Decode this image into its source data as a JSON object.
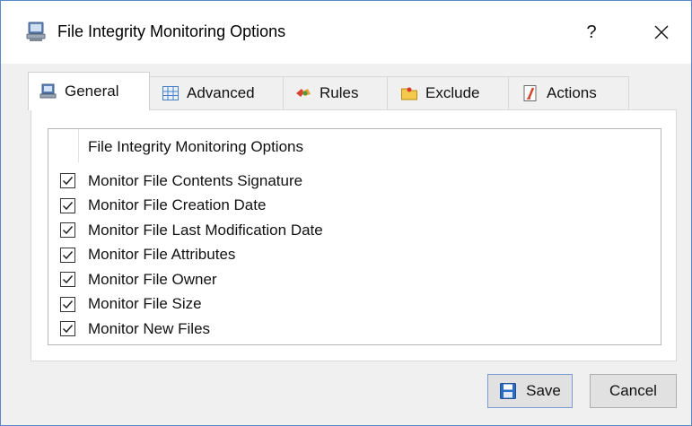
{
  "window": {
    "title": "File Integrity Monitoring Options",
    "help_glyph": "?",
    "close_glyph": "×"
  },
  "tabs": [
    {
      "label": "General",
      "icon": "computer-icon",
      "active": true
    },
    {
      "label": "Advanced",
      "icon": "grid-icon",
      "active": false
    },
    {
      "label": "Rules",
      "icon": "rules-icon",
      "active": false
    },
    {
      "label": "Exclude",
      "icon": "folder-icon",
      "active": false
    },
    {
      "label": "Actions",
      "icon": "actions-icon",
      "active": false
    }
  ],
  "list": {
    "header": "File Integrity Monitoring Options",
    "items": [
      {
        "label": "Monitor File Contents Signature",
        "checked": true
      },
      {
        "label": "Monitor File Creation Date",
        "checked": true
      },
      {
        "label": "Monitor File Last Modification Date",
        "checked": true
      },
      {
        "label": "Monitor File Attributes",
        "checked": true
      },
      {
        "label": "Monitor File Owner",
        "checked": true
      },
      {
        "label": "Monitor File Size",
        "checked": true
      },
      {
        "label": "Monitor New Files",
        "checked": true
      }
    ]
  },
  "buttons": {
    "save": "Save",
    "cancel": "Cancel"
  },
  "colors": {
    "window_border": "#5a89c9",
    "dialog_bg": "#f0f0f0",
    "accent_blue": "#2b6cc4"
  }
}
